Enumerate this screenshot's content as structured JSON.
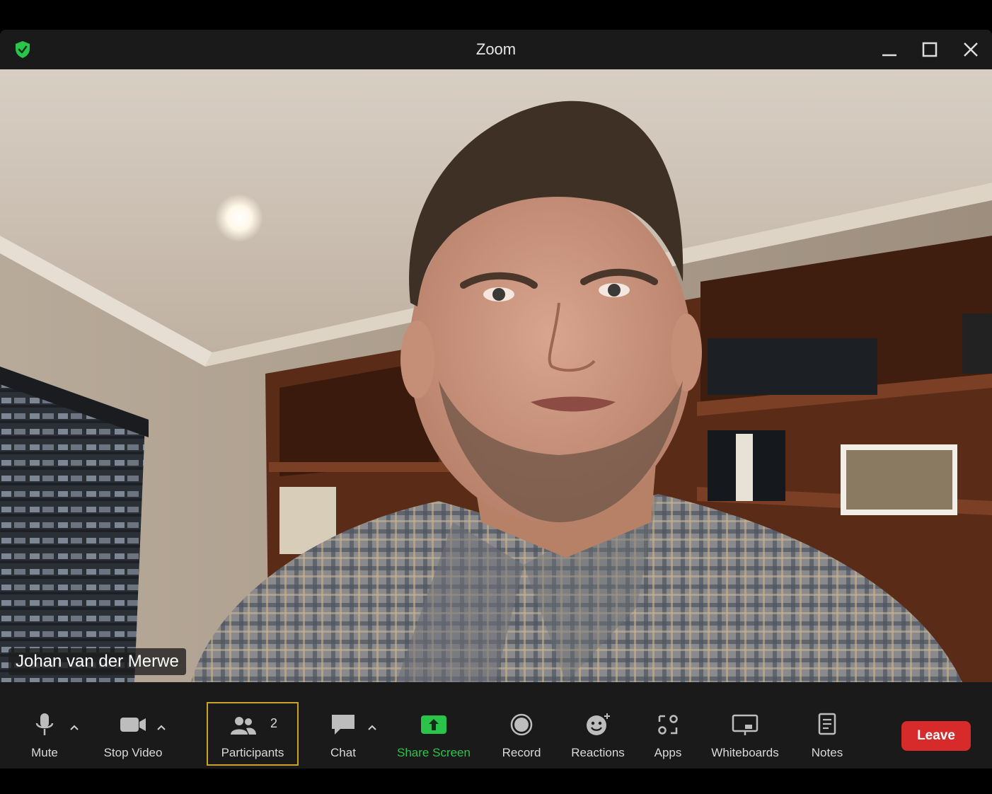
{
  "window": {
    "title": "Zoom",
    "accent_shield_color": "#2ac44a"
  },
  "video": {
    "participant_name": "Johan van der Merwe"
  },
  "toolbar": {
    "mute": {
      "label": "Mute",
      "icon": "microphone-icon"
    },
    "stop_video": {
      "label": "Stop Video",
      "icon": "video-camera-icon"
    },
    "participants": {
      "label": "Participants",
      "count": "2",
      "icon": "participants-icon"
    },
    "chat": {
      "label": "Chat",
      "icon": "chat-bubble-icon"
    },
    "share_screen": {
      "label": "Share Screen",
      "icon": "share-screen-icon",
      "color": "#2ac44a"
    },
    "record": {
      "label": "Record",
      "icon": "record-icon"
    },
    "reactions": {
      "label": "Reactions",
      "icon": "smiley-icon"
    },
    "apps": {
      "label": "Apps",
      "icon": "apps-icon"
    },
    "whiteboards": {
      "label": "Whiteboards",
      "icon": "whiteboard-icon"
    },
    "notes": {
      "label": "Notes",
      "icon": "notes-icon"
    },
    "leave": {
      "label": "Leave",
      "color": "#d72b2b"
    }
  }
}
